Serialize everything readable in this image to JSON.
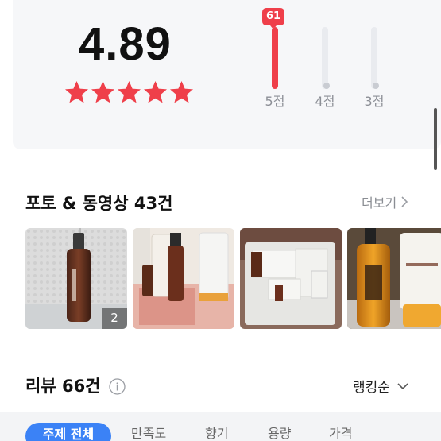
{
  "rating": {
    "score": "4.89",
    "stars": 5,
    "star_color": "#ef3f4a",
    "distribution": [
      {
        "label": "5점",
        "count": "61",
        "fill": 1.0,
        "active": true
      },
      {
        "label": "4점",
        "fill": 0,
        "active": false
      },
      {
        "label": "3점",
        "fill": 0,
        "active": false
      }
    ]
  },
  "photos_section": {
    "title": "포토 & 동영상 43건",
    "more_label": "더보기",
    "thumbnails": [
      {
        "count": "2"
      },
      {},
      {},
      {}
    ]
  },
  "reviews_section": {
    "title": "리뷰 66건",
    "info_icon": "info-icon",
    "sort_label": "랭킹순"
  },
  "filters": {
    "active": "주제 전체",
    "items": [
      "만족도",
      "향기",
      "용량",
      "가격"
    ]
  },
  "colors": {
    "accent_red": "#ef3f4a",
    "accent_blue": "#3b82f6"
  }
}
